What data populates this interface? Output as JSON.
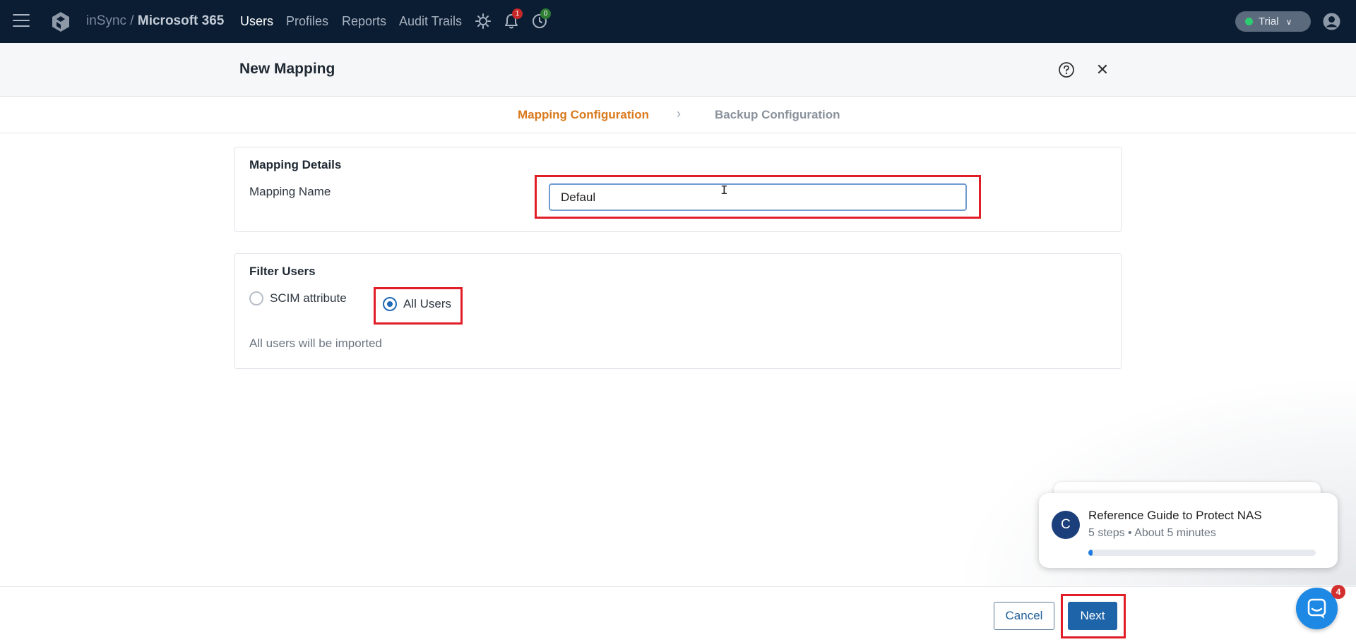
{
  "topbar": {
    "brand_prefix": "inSync /",
    "brand_product": "Microsoft 365",
    "nav": [
      {
        "label": "Users",
        "active": true
      },
      {
        "label": "Profiles",
        "active": false
      },
      {
        "label": "Reports",
        "active": false
      },
      {
        "label": "Audit Trails",
        "active": false
      }
    ],
    "notifications_count": "1",
    "jobs_count": "0",
    "trial_label": "Trial",
    "icons": [
      "hamburger-icon",
      "logo-icon",
      "settings-icon",
      "bell-icon",
      "clock-icon",
      "user-avatar-icon"
    ]
  },
  "header": {
    "title": "New Mapping"
  },
  "stepper": {
    "steps": [
      {
        "label": "Mapping Configuration",
        "state": "current"
      },
      {
        "label": "Backup Configuration",
        "state": "upcoming"
      }
    ]
  },
  "mapping_details": {
    "title": "Mapping Details",
    "name_label": "Mapping Name",
    "name_value": "Defaul"
  },
  "filter_users": {
    "title": "Filter Users",
    "options": [
      {
        "label": "SCIM attribute",
        "checked": false
      },
      {
        "label": "All Users",
        "checked": true
      }
    ],
    "helper_text": "All users will be imported"
  },
  "footer": {
    "cancel_label": "Cancel",
    "next_label": "Next"
  },
  "guide": {
    "avatar_letter": "C",
    "title": "Reference Guide to Protect NAS",
    "subtitle": "5 steps • About 5 minutes",
    "progress": 0.02
  },
  "chat": {
    "unread_count": "4"
  },
  "colors": {
    "topbar_bg": "#0b1d33",
    "accent_orange": "#d9791d",
    "primary_blue": "#1e64a8",
    "highlight_red": "#e11d27"
  }
}
